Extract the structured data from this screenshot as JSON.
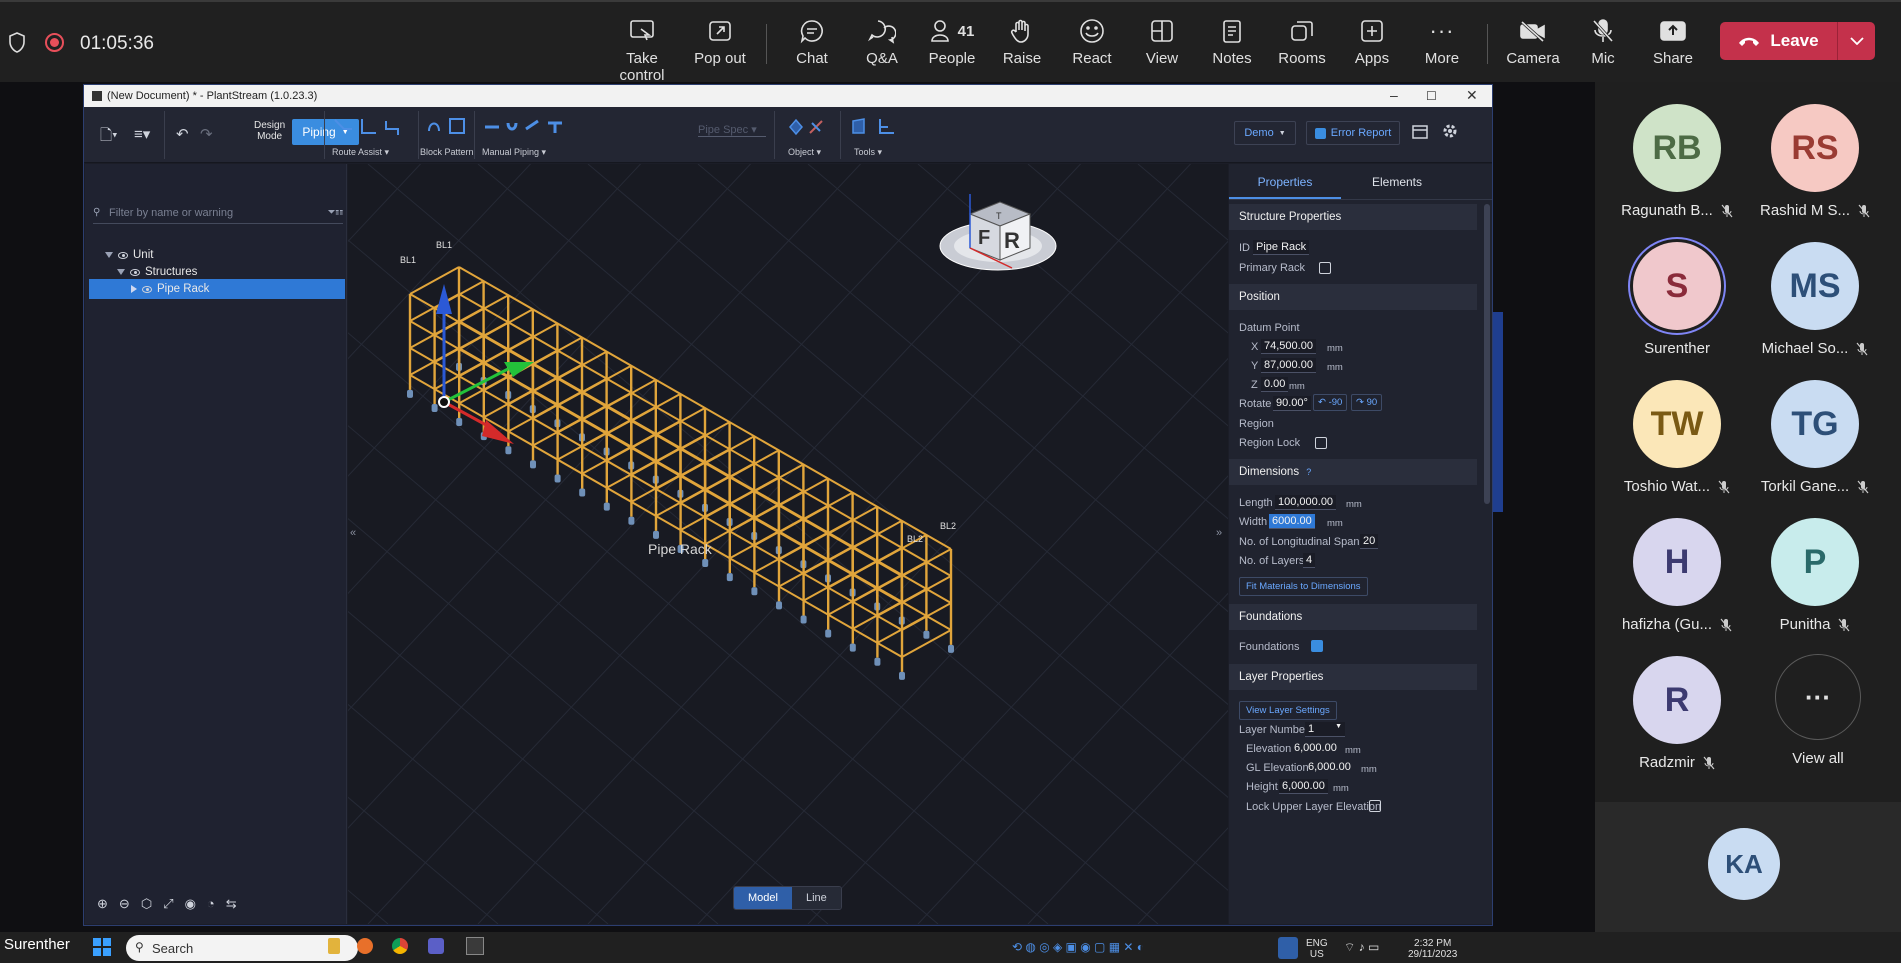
{
  "meeting": {
    "timer": "01:05:36",
    "buttons": [
      {
        "id": "take-control",
        "label": "Take control"
      },
      {
        "id": "pop-out",
        "label": "Pop out"
      },
      {
        "id": "chat",
        "label": "Chat"
      },
      {
        "id": "qa",
        "label": "Q&A"
      },
      {
        "id": "people",
        "label": "People",
        "count": "41"
      },
      {
        "id": "raise",
        "label": "Raise"
      },
      {
        "id": "react",
        "label": "React"
      },
      {
        "id": "view",
        "label": "View"
      },
      {
        "id": "notes",
        "label": "Notes"
      },
      {
        "id": "rooms",
        "label": "Rooms"
      },
      {
        "id": "apps",
        "label": "Apps"
      },
      {
        "id": "more",
        "label": "More"
      },
      {
        "id": "camera",
        "label": "Camera"
      },
      {
        "id": "mic",
        "label": "Mic"
      },
      {
        "id": "share",
        "label": "Share"
      }
    ],
    "leave_label": "Leave",
    "leave_color": "#c4314b"
  },
  "plantstream": {
    "title": "(New Document) * - PlantStream (1.0.23.3)",
    "toolbar": {
      "design_mode_line1": "Design",
      "design_mode_line2": "Mode",
      "piping": "Piping",
      "route_assist": "Route Assist",
      "block_pattern": "Block Pattern",
      "manual_piping": "Manual Piping",
      "pipe_spec": "Pipe Spec",
      "object": "Object",
      "tools": "Tools",
      "demo": "Demo",
      "error_report": "Error Report"
    },
    "tree": {
      "filter_placeholder": "Filter by name or warning",
      "unit": "Unit",
      "structures": "Structures",
      "pipe_rack": "Pipe Rack"
    },
    "viewport": {
      "label": "Pipe Rack",
      "marker_bl1_a": "BL1",
      "marker_bl1_b": "BL1",
      "marker_bl2_a": "BL2",
      "marker_bl2_b": "BL2",
      "view_modes": [
        "Model",
        "Line"
      ],
      "active_view_mode": "Model",
      "cube_faces": {
        "front": "F",
        "right": "R",
        "top": "T"
      }
    },
    "properties": {
      "tabs": [
        "Properties",
        "Elements"
      ],
      "active_tab": "Properties",
      "structure_header": "Structure Properties",
      "id_label": "ID",
      "id_value": "Pipe Rack",
      "primary_rack_label": "Primary Rack",
      "position_header": "Position",
      "datum_point_label": "Datum Point",
      "x_label": "X",
      "x_value": "74,500.00",
      "y_label": "Y",
      "y_value": "87,000.00",
      "z_label": "Z",
      "z_value": "0.00",
      "unit_mm": "mm",
      "rotate_label": "Rotate",
      "rotate_value": "90.00°",
      "rotate_minus": "-90",
      "rotate_plus": "90",
      "region_label": "Region",
      "region_lock_label": "Region Lock",
      "dimensions_header": "Dimensions",
      "dimensions_help": "?",
      "length_label": "Length",
      "length_value": "100,000.00",
      "width_label": "Width",
      "width_value": "6000.00",
      "long_span_label": "No. of Longitudinal Span",
      "long_span_value": "20",
      "layers_label": "No. of Layers",
      "layers_value": "4",
      "fit_button": "Fit Materials to Dimensions",
      "foundations_header": "Foundations",
      "foundations_label": "Foundations",
      "foundations_checked": true,
      "layer_props_header": "Layer Properties",
      "view_layer_button": "View Layer Settings",
      "layer_number_label": "Layer Number",
      "layer_number_value": "1",
      "elevation_label": "Elevation",
      "elevation_value": "6,000.00",
      "gl_elevation_label": "GL Elevation",
      "gl_elevation_value": "6,000.00",
      "height_label": "Height",
      "height_value": "6,000.00",
      "lock_upper_label": "Lock Upper Layer Elevation"
    }
  },
  "participants": [
    {
      "initials": "RB",
      "name": "Ragunath B...",
      "bg": "#cfe3c8",
      "fg": "#4d6b45",
      "muted": true
    },
    {
      "initials": "RS",
      "name": "Rashid M S...",
      "bg": "#f6c9c3",
      "fg": "#9a3b33",
      "muted": true
    },
    {
      "initials": "S",
      "name": "Surenther",
      "bg": "#f0c8cc",
      "fg": "#8a2b3a",
      "muted": false
    },
    {
      "initials": "MS",
      "name": "Michael So...",
      "bg": "#c9dcf2",
      "fg": "#2d4f78",
      "muted": true
    },
    {
      "initials": "TW",
      "name": "Toshio Wat...",
      "bg": "#fbe7b8",
      "fg": "#7a5a14",
      "muted": true
    },
    {
      "initials": "TG",
      "name": "Torkil Gane...",
      "bg": "#c9dcf2",
      "fg": "#2d4f78",
      "muted": true
    },
    {
      "initials": "H",
      "name": "hafizha (Gu...",
      "bg": "#d8d6ee",
      "fg": "#3c3a70",
      "muted": true
    },
    {
      "initials": "P",
      "name": "Punitha",
      "bg": "#c8ecec",
      "fg": "#2a6a6a",
      "muted": true
    },
    {
      "initials": "R",
      "name": "Radzmir",
      "bg": "#d8d6ee",
      "fg": "#3c3a70",
      "muted": true
    }
  ],
  "view_all_label": "View all",
  "self_initials": "KA",
  "taskbar": {
    "self_name": "Surenther",
    "search_placeholder": "Search",
    "lang_line1": "ENG",
    "lang_line2": "US",
    "time": "2:32 PM",
    "date": "29/11/2023"
  }
}
